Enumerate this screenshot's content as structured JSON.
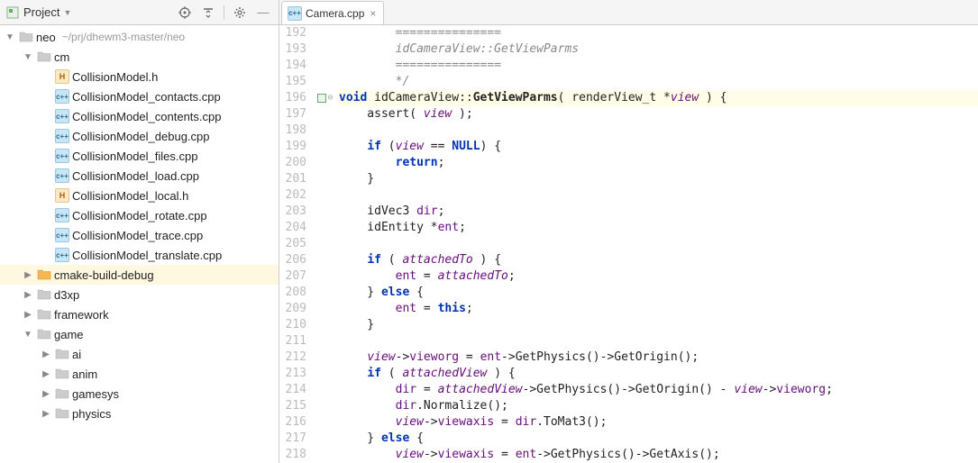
{
  "sidebar": {
    "title": "Project",
    "rootName": "neo",
    "rootPath": "~/prj/dhewm3-master/neo",
    "tree": [
      {
        "indent": 0,
        "arrow": "down",
        "icon": "folder",
        "label": "neo",
        "path": "~/prj/dhewm3-master/neo"
      },
      {
        "indent": 1,
        "arrow": "down",
        "icon": "folder",
        "label": "cm"
      },
      {
        "indent": 2,
        "arrow": "none",
        "icon": "h",
        "label": "CollisionModel.h"
      },
      {
        "indent": 2,
        "arrow": "none",
        "icon": "cpp",
        "label": "CollisionModel_contacts.cpp"
      },
      {
        "indent": 2,
        "arrow": "none",
        "icon": "cpp",
        "label": "CollisionModel_contents.cpp"
      },
      {
        "indent": 2,
        "arrow": "none",
        "icon": "cpp",
        "label": "CollisionModel_debug.cpp"
      },
      {
        "indent": 2,
        "arrow": "none",
        "icon": "cpp",
        "label": "CollisionModel_files.cpp"
      },
      {
        "indent": 2,
        "arrow": "none",
        "icon": "cpp",
        "label": "CollisionModel_load.cpp"
      },
      {
        "indent": 2,
        "arrow": "none",
        "icon": "h",
        "label": "CollisionModel_local.h"
      },
      {
        "indent": 2,
        "arrow": "none",
        "icon": "cpp",
        "label": "CollisionModel_rotate.cpp"
      },
      {
        "indent": 2,
        "arrow": "none",
        "icon": "cpp",
        "label": "CollisionModel_trace.cpp"
      },
      {
        "indent": 2,
        "arrow": "none",
        "icon": "cpp",
        "label": "CollisionModel_translate.cpp"
      },
      {
        "indent": 1,
        "arrow": "right",
        "icon": "folder-orange",
        "label": "cmake-build-debug",
        "highlight": true
      },
      {
        "indent": 1,
        "arrow": "right",
        "icon": "folder",
        "label": "d3xp"
      },
      {
        "indent": 1,
        "arrow": "right",
        "icon": "folder",
        "label": "framework"
      },
      {
        "indent": 1,
        "arrow": "down",
        "icon": "folder",
        "label": "game"
      },
      {
        "indent": 2,
        "arrow": "right",
        "icon": "folder",
        "label": "ai"
      },
      {
        "indent": 2,
        "arrow": "right",
        "icon": "folder",
        "label": "anim"
      },
      {
        "indent": 2,
        "arrow": "right",
        "icon": "folder",
        "label": "gamesys"
      },
      {
        "indent": 2,
        "arrow": "right",
        "icon": "folder",
        "label": "physics"
      }
    ]
  },
  "tabs": [
    {
      "icon": "cpp",
      "label": "Camera.cpp"
    }
  ],
  "code": {
    "startLine": 192,
    "lines": [
      {
        "n": 192,
        "segs": [
          {
            "t": "        ===============",
            "c": "com"
          }
        ]
      },
      {
        "n": 193,
        "segs": [
          {
            "t": "        idCameraView::GetViewParms",
            "c": "com"
          }
        ]
      },
      {
        "n": 194,
        "segs": [
          {
            "t": "        ===============",
            "c": "com"
          }
        ]
      },
      {
        "n": 195,
        "segs": [
          {
            "t": "        */",
            "c": "com"
          }
        ]
      },
      {
        "n": 196,
        "hl": true,
        "mark": "box",
        "fold": true,
        "segs": [
          {
            "t": "void",
            "c": "kw"
          },
          {
            "t": " idCameraView",
            "c": "fn"
          },
          {
            "t": "::",
            "c": "op"
          },
          {
            "t": "GetViewParms",
            "c": "fnbold"
          },
          {
            "t": "( renderView_t *",
            "c": "op"
          },
          {
            "t": "view",
            "c": "ident"
          },
          {
            "t": " ) {",
            "c": "op"
          }
        ]
      },
      {
        "n": 197,
        "segs": [
          {
            "t": "    assert( ",
            "c": "op"
          },
          {
            "t": "view",
            "c": "ident"
          },
          {
            "t": " );",
            "c": "op"
          }
        ]
      },
      {
        "n": 198,
        "segs": [
          {
            "t": "",
            "c": "op"
          }
        ]
      },
      {
        "n": 199,
        "segs": [
          {
            "t": "    ",
            "c": "op"
          },
          {
            "t": "if",
            "c": "kw"
          },
          {
            "t": " (",
            "c": "op"
          },
          {
            "t": "view",
            "c": "ident"
          },
          {
            "t": " == ",
            "c": "op"
          },
          {
            "t": "NULL",
            "c": "kw"
          },
          {
            "t": ") {",
            "c": "op"
          }
        ]
      },
      {
        "n": 200,
        "segs": [
          {
            "t": "        ",
            "c": "op"
          },
          {
            "t": "return",
            "c": "kw"
          },
          {
            "t": ";",
            "c": "op"
          }
        ]
      },
      {
        "n": 201,
        "segs": [
          {
            "t": "    }",
            "c": "op"
          }
        ]
      },
      {
        "n": 202,
        "segs": [
          {
            "t": "",
            "c": "op"
          }
        ]
      },
      {
        "n": 203,
        "segs": [
          {
            "t": "    idVec3 ",
            "c": "op"
          },
          {
            "t": "dir",
            "c": "purple"
          },
          {
            "t": ";",
            "c": "op"
          }
        ]
      },
      {
        "n": 204,
        "segs": [
          {
            "t": "    idEntity *",
            "c": "op"
          },
          {
            "t": "ent",
            "c": "purple"
          },
          {
            "t": ";",
            "c": "op"
          }
        ]
      },
      {
        "n": 205,
        "segs": [
          {
            "t": "",
            "c": "op"
          }
        ]
      },
      {
        "n": 206,
        "segs": [
          {
            "t": "    ",
            "c": "op"
          },
          {
            "t": "if",
            "c": "kw"
          },
          {
            "t": " ( ",
            "c": "op"
          },
          {
            "t": "attachedTo",
            "c": "ident"
          },
          {
            "t": " ) {",
            "c": "op"
          }
        ]
      },
      {
        "n": 207,
        "segs": [
          {
            "t": "        ",
            "c": "op"
          },
          {
            "t": "ent",
            "c": "purple"
          },
          {
            "t": " = ",
            "c": "op"
          },
          {
            "t": "attachedTo",
            "c": "ident"
          },
          {
            "t": ";",
            "c": "op"
          }
        ]
      },
      {
        "n": 208,
        "segs": [
          {
            "t": "    } ",
            "c": "op"
          },
          {
            "t": "else",
            "c": "kw"
          },
          {
            "t": " {",
            "c": "op"
          }
        ]
      },
      {
        "n": 209,
        "segs": [
          {
            "t": "        ",
            "c": "op"
          },
          {
            "t": "ent",
            "c": "purple"
          },
          {
            "t": " = ",
            "c": "op"
          },
          {
            "t": "this",
            "c": "kw"
          },
          {
            "t": ";",
            "c": "op"
          }
        ]
      },
      {
        "n": 210,
        "segs": [
          {
            "t": "    }",
            "c": "op"
          }
        ]
      },
      {
        "n": 211,
        "segs": [
          {
            "t": "",
            "c": "op"
          }
        ]
      },
      {
        "n": 212,
        "segs": [
          {
            "t": "    ",
            "c": "op"
          },
          {
            "t": "view",
            "c": "ident"
          },
          {
            "t": "->",
            "c": "op"
          },
          {
            "t": "vieworg",
            "c": "purple"
          },
          {
            "t": " = ",
            "c": "op"
          },
          {
            "t": "ent",
            "c": "purple"
          },
          {
            "t": "->GetPhysics()->GetOrigin();",
            "c": "op"
          }
        ]
      },
      {
        "n": 213,
        "segs": [
          {
            "t": "    ",
            "c": "op"
          },
          {
            "t": "if",
            "c": "kw"
          },
          {
            "t": " ( ",
            "c": "op"
          },
          {
            "t": "attachedView",
            "c": "ident"
          },
          {
            "t": " ) {",
            "c": "op"
          }
        ]
      },
      {
        "n": 214,
        "segs": [
          {
            "t": "        ",
            "c": "op"
          },
          {
            "t": "dir",
            "c": "purple"
          },
          {
            "t": " = ",
            "c": "op"
          },
          {
            "t": "attachedView",
            "c": "ident"
          },
          {
            "t": "->GetPhysics()->GetOrigin() - ",
            "c": "op"
          },
          {
            "t": "view",
            "c": "ident"
          },
          {
            "t": "->",
            "c": "op"
          },
          {
            "t": "vieworg",
            "c": "purple"
          },
          {
            "t": ";",
            "c": "op"
          }
        ]
      },
      {
        "n": 215,
        "segs": [
          {
            "t": "        ",
            "c": "op"
          },
          {
            "t": "dir",
            "c": "purple"
          },
          {
            "t": ".Normalize();",
            "c": "op"
          }
        ]
      },
      {
        "n": 216,
        "segs": [
          {
            "t": "        ",
            "c": "op"
          },
          {
            "t": "view",
            "c": "ident"
          },
          {
            "t": "->",
            "c": "op"
          },
          {
            "t": "viewaxis",
            "c": "purple"
          },
          {
            "t": " = ",
            "c": "op"
          },
          {
            "t": "dir",
            "c": "purple"
          },
          {
            "t": ".ToMat3();",
            "c": "op"
          }
        ]
      },
      {
        "n": 217,
        "segs": [
          {
            "t": "    } ",
            "c": "op"
          },
          {
            "t": "else",
            "c": "kw"
          },
          {
            "t": " {",
            "c": "op"
          }
        ]
      },
      {
        "n": 218,
        "segs": [
          {
            "t": "        ",
            "c": "op"
          },
          {
            "t": "view",
            "c": "ident"
          },
          {
            "t": "->",
            "c": "op"
          },
          {
            "t": "viewaxis",
            "c": "purple"
          },
          {
            "t": " = ",
            "c": "op"
          },
          {
            "t": "ent",
            "c": "purple"
          },
          {
            "t": "->GetPhysics()->GetAxis();",
            "c": "op"
          }
        ]
      }
    ]
  }
}
